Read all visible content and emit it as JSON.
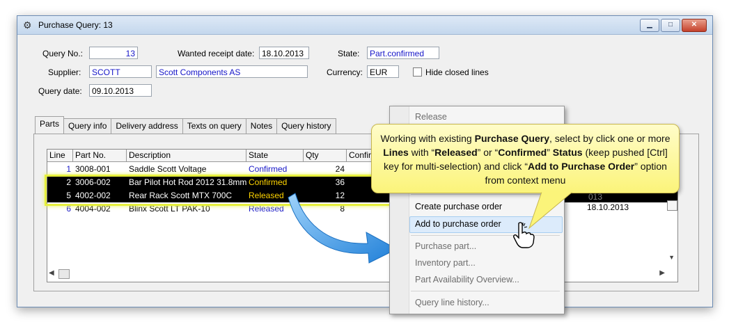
{
  "window": {
    "title": "Purchase Query: 13",
    "buttons": {
      "minimize": "▁",
      "maximize": "□",
      "close": "✕"
    }
  },
  "header": {
    "query_no_label": "Query No.:",
    "query_no": "13",
    "wanted_receipt_label": "Wanted receipt date:",
    "wanted_receipt_date": "18.10.2013",
    "state_label": "State:",
    "state": "Part.confirmed",
    "supplier_label": "Supplier:",
    "supplier_code": "SCOTT",
    "supplier_name": "Scott Components AS",
    "currency_label": "Currency:",
    "currency": "EUR",
    "hide_closed_label": "Hide closed lines",
    "query_date_label": "Query date:",
    "query_date": "09.10.2013"
  },
  "tabs": [
    "Parts",
    "Query info",
    "Delivery address",
    "Texts on query",
    "Notes",
    "Query history"
  ],
  "grid": {
    "columns": [
      "Line",
      "Part No.",
      "Description",
      "State",
      "Qty",
      "Confir"
    ],
    "rows": [
      {
        "line": "1",
        "part": "3008-001",
        "desc": "Saddle Scott Voltage",
        "state": "Confirmed",
        "qty": "24"
      },
      {
        "line": "2",
        "part": "3006-002",
        "desc": "Bar Pilot Hot Rod 2012 31.8mm (",
        "state": "Confirmed",
        "qty": "36"
      },
      {
        "line": "5",
        "part": "4002-002",
        "desc": "Rear Rack Scott MTX 700C",
        "state": "Released",
        "qty": "12"
      },
      {
        "line": "6",
        "part": "4004-002",
        "desc": "Blinx Scott LT PAK-10",
        "state": "Released",
        "qty": "8"
      }
    ],
    "partial_date": "18.10.2013",
    "partial_date_fragment": "013"
  },
  "context_menu": {
    "items": [
      {
        "label": "Release",
        "enabled": false
      },
      {
        "label": "Create purchase order",
        "enabled": true
      },
      {
        "label": "Add to purchase order",
        "enabled": true
      },
      {
        "label": "Purchase part...",
        "enabled": false
      },
      {
        "label": "Inventory part...",
        "enabled": false
      },
      {
        "label": "Part Availability Overview...",
        "enabled": false
      },
      {
        "label": "Query line history...",
        "enabled": false
      }
    ]
  },
  "callout": {
    "t1": "Working with existing ",
    "b1": "Purchase Query",
    "t2": ", select by click one or more ",
    "b2": "Lines",
    "t3": " with “",
    "b3": "Released",
    "t4": "” or “",
    "b4": "Confirmed",
    "t5": "” ",
    "b5": "Status",
    "t6": " (keep pushed [Ctrl] key for multi-selection) and click “",
    "b6": "Add to Purchase Order",
    "t7": "” option from context menu"
  },
  "colors": {
    "highlight": "#e6f03c",
    "callout_bg": "#fbf47a",
    "arrow": "#2d8fe0",
    "state_text": "#1515c8"
  }
}
